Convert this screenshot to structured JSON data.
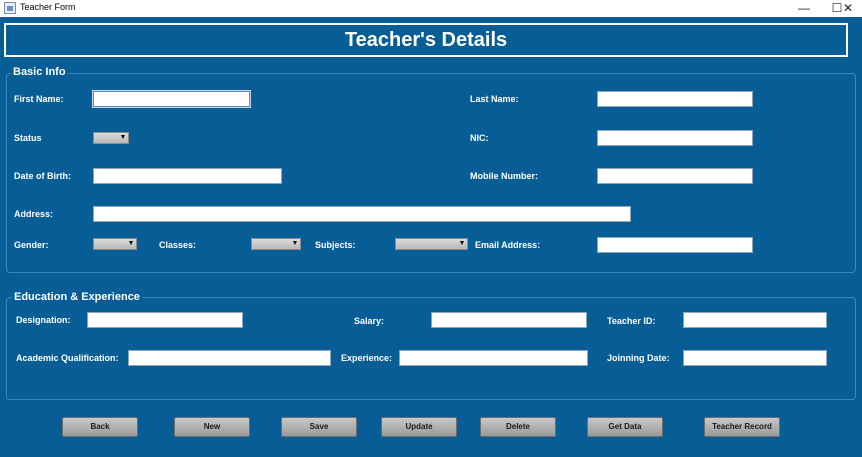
{
  "window": {
    "title": "Teacher Form",
    "minimize": "—",
    "maximize": "☐",
    "close": "✕"
  },
  "header": {
    "title": "Teacher's Details"
  },
  "basic_info": {
    "legend": "Basic Info",
    "first_name_label": "First Name:",
    "last_name_label": "Last Name:",
    "status_label": "Status",
    "nic_label": "NIC:",
    "dob_label": "Date of Birth:",
    "mobile_label": "Mobile Number:",
    "address_label": "Address:",
    "gender_label": "Gender:",
    "classes_label": "Classes:",
    "subjects_label": "Subjects:",
    "email_label": "Email Address:"
  },
  "education": {
    "legend": "Education & Experience",
    "designation_label": "Designation:",
    "salary_label": "Salary:",
    "teacher_id_label": "Teacher ID:",
    "qualification_label": "Academic Qualification:",
    "experience_label": "Experience:",
    "joining_date_label": "Joinning Date:"
  },
  "buttons": {
    "back": "Back",
    "new": "New",
    "save": "Save",
    "update": "Update",
    "delete": "Delete",
    "get_data": "Get Data",
    "teacher_record": "Teacher Record"
  },
  "colors": {
    "background": "#075e96",
    "text": "#ffffff",
    "button": "#b0b0b0"
  }
}
